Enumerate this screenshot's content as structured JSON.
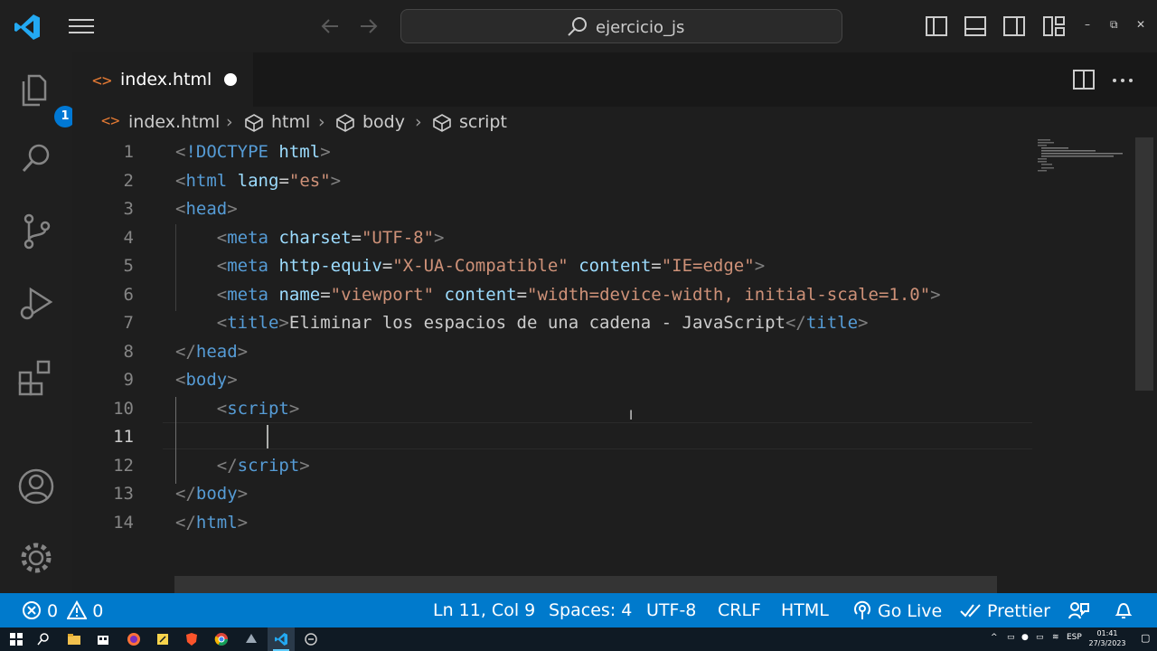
{
  "search": {
    "text": "ejercicio_js"
  },
  "window_controls": {
    "minimize": "–",
    "restore": "⧉",
    "close": "✕"
  },
  "explorer_badge": "1",
  "tab": {
    "label": "index.html",
    "icon": "<>"
  },
  "breadcrumb": {
    "file_icon": "<>",
    "items": [
      "index.html",
      "html",
      "body",
      "script"
    ]
  },
  "editor": {
    "line_numbers": [
      "1",
      "2",
      "3",
      "4",
      "5",
      "6",
      "7",
      "8",
      "9",
      "10",
      "11",
      "12",
      "13",
      "14"
    ],
    "active_line": "11",
    "lines": [
      [
        [
          "t-br",
          "<"
        ],
        [
          "t-tag",
          "!DOCTYPE"
        ],
        [
          "t-txt",
          " "
        ],
        [
          "t-attr",
          "html"
        ],
        [
          "t-br",
          ">"
        ]
      ],
      [
        [
          "t-br",
          "<"
        ],
        [
          "t-tag",
          "html"
        ],
        [
          "t-txt",
          " "
        ],
        [
          "t-attr",
          "lang"
        ],
        [
          "t-txt",
          "="
        ],
        [
          "t-str",
          "\"es\""
        ],
        [
          "t-br",
          ">"
        ]
      ],
      [
        [
          "t-br",
          "<"
        ],
        [
          "t-tag",
          "head"
        ],
        [
          "t-br",
          ">"
        ]
      ],
      [
        [
          "t-txt",
          "    "
        ],
        [
          "t-br",
          "<"
        ],
        [
          "t-tag",
          "meta"
        ],
        [
          "t-txt",
          " "
        ],
        [
          "t-attr",
          "charset"
        ],
        [
          "t-txt",
          "="
        ],
        [
          "t-str",
          "\"UTF-8\""
        ],
        [
          "t-br",
          ">"
        ]
      ],
      [
        [
          "t-txt",
          "    "
        ],
        [
          "t-br",
          "<"
        ],
        [
          "t-tag",
          "meta"
        ],
        [
          "t-txt",
          " "
        ],
        [
          "t-attr",
          "http-equiv"
        ],
        [
          "t-txt",
          "="
        ],
        [
          "t-str",
          "\"X-UA-Compatible\""
        ],
        [
          "t-txt",
          " "
        ],
        [
          "t-attr",
          "content"
        ],
        [
          "t-txt",
          "="
        ],
        [
          "t-str",
          "\"IE=edge\""
        ],
        [
          "t-br",
          ">"
        ]
      ],
      [
        [
          "t-txt",
          "    "
        ],
        [
          "t-br",
          "<"
        ],
        [
          "t-tag",
          "meta"
        ],
        [
          "t-txt",
          " "
        ],
        [
          "t-attr",
          "name"
        ],
        [
          "t-txt",
          "="
        ],
        [
          "t-str",
          "\"viewport\""
        ],
        [
          "t-txt",
          " "
        ],
        [
          "t-attr",
          "content"
        ],
        [
          "t-txt",
          "="
        ],
        [
          "t-str",
          "\"width=device-width, initial-scale=1.0\""
        ],
        [
          "t-br",
          ">"
        ]
      ],
      [
        [
          "t-txt",
          "    "
        ],
        [
          "t-br",
          "<"
        ],
        [
          "t-tag",
          "title"
        ],
        [
          "t-br",
          ">"
        ],
        [
          "t-txt",
          "Eliminar los espacios de una cadena - JavaScript"
        ],
        [
          "t-br",
          "</"
        ],
        [
          "t-tag",
          "title"
        ],
        [
          "t-br",
          ">"
        ]
      ],
      [
        [
          "t-br",
          "</"
        ],
        [
          "t-tag",
          "head"
        ],
        [
          "t-br",
          ">"
        ]
      ],
      [
        [
          "t-br",
          "<"
        ],
        [
          "t-tag",
          "body"
        ],
        [
          "t-br",
          ">"
        ]
      ],
      [
        [
          "t-txt",
          "    "
        ],
        [
          "t-br",
          "<"
        ],
        [
          "t-tag",
          "script"
        ],
        [
          "t-br",
          ">"
        ]
      ],
      [
        [
          "t-txt",
          "        "
        ]
      ],
      [
        [
          "t-txt",
          "    "
        ],
        [
          "t-br",
          "</"
        ],
        [
          "t-tag",
          "script"
        ],
        [
          "t-br",
          ">"
        ]
      ],
      [
        [
          "t-br",
          "</"
        ],
        [
          "t-tag",
          "body"
        ],
        [
          "t-br",
          ">"
        ]
      ],
      [
        [
          "t-br",
          "</"
        ],
        [
          "t-tag",
          "html"
        ],
        [
          "t-br",
          ">"
        ]
      ]
    ]
  },
  "status": {
    "errors": "0",
    "warnings": "0",
    "position": "Ln 11, Col 9",
    "spaces": "Spaces: 4",
    "encoding": "UTF-8",
    "eol": "CRLF",
    "language": "HTML",
    "golive": "Go Live",
    "prettier": "Prettier"
  },
  "taskbar": {
    "lang": "ESP",
    "time": "01:41",
    "date": "27/3/2023"
  },
  "colors": {
    "status_bar": "#007acc",
    "tag": "#569cd6",
    "attribute": "#9cdcfe",
    "string": "#ce9178",
    "bracket": "#808080"
  }
}
